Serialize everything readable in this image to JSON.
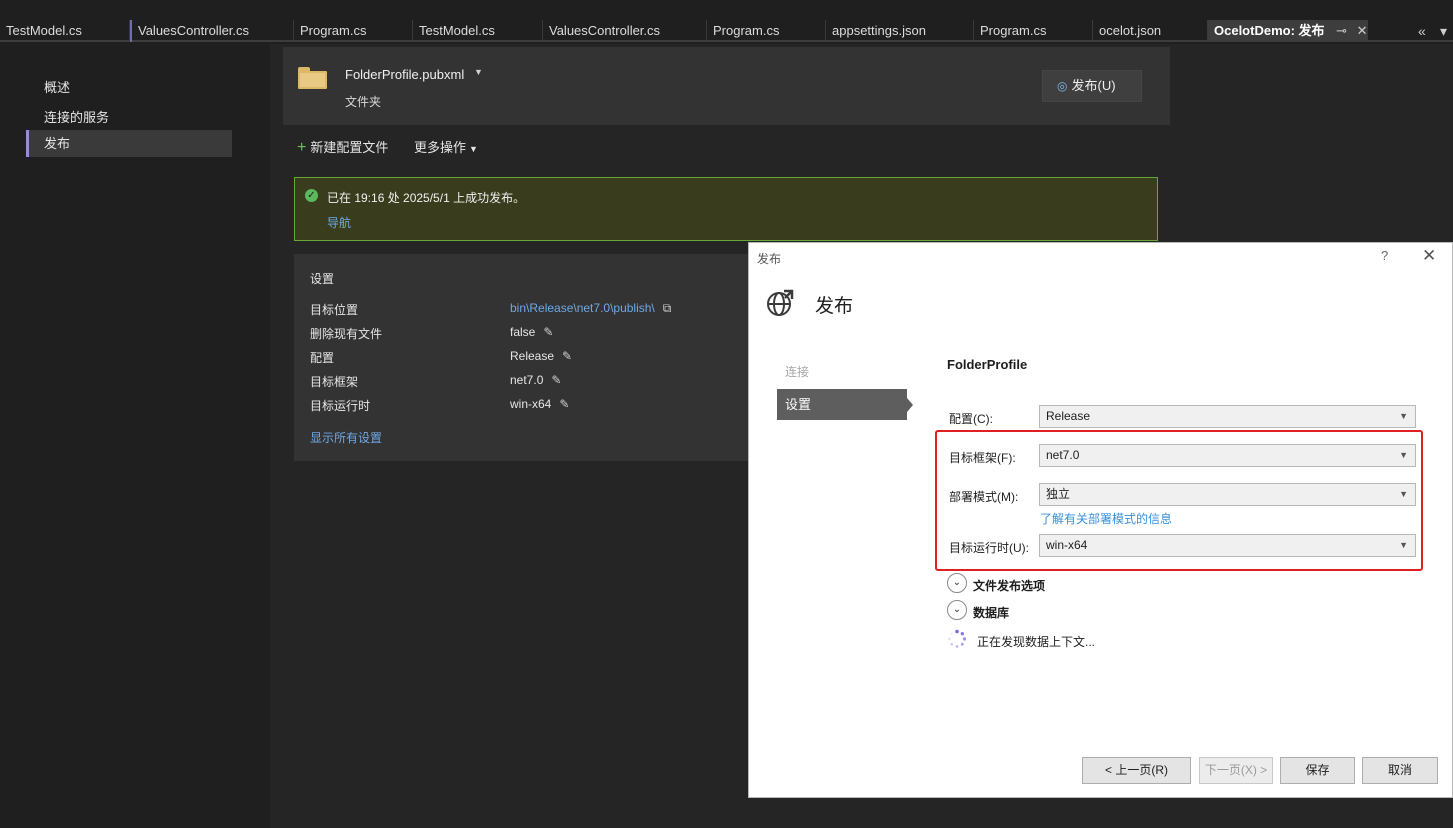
{
  "tabs": [
    {
      "label": "TestModel.cs"
    },
    {
      "label": "ValuesController.cs"
    },
    {
      "label": "Program.cs"
    },
    {
      "label": "TestModel.cs"
    },
    {
      "label": "ValuesController.cs"
    },
    {
      "label": "Program.cs"
    },
    {
      "label": "appsettings.json"
    },
    {
      "label": "Program.cs"
    },
    {
      "label": "ocelot.json"
    }
  ],
  "active_tab": {
    "label": "OcelotDemo: 发布",
    "pin_icon": "pin-icon",
    "close_icon": "close-icon"
  },
  "tab_overflow": {
    "label": "«"
  },
  "left_nav": [
    {
      "label": "概述"
    },
    {
      "label": "连接的服务"
    },
    {
      "label": "发布",
      "selected": true
    }
  ],
  "profile": {
    "name": "FolderProfile.pubxml",
    "type": "文件夹",
    "publish_button": "发布(U)"
  },
  "actions": {
    "new_profile": "新建配置文件",
    "more_actions": "更多操作"
  },
  "banner": {
    "message": "已在 19:16 处 2025/5/1 上成功发布。",
    "link": "导航"
  },
  "settings": {
    "title": "设置",
    "rows": [
      {
        "label": "目标位置",
        "value": "bin\\Release\\net7.0\\publish\\"
      },
      {
        "label": "删除现有文件",
        "value": "false"
      },
      {
        "label": "配置",
        "value": "Release"
      },
      {
        "label": "目标框架",
        "value": "net7.0"
      },
      {
        "label": "目标运行时",
        "value": "win-x64"
      }
    ],
    "show_all": "显示所有设置"
  },
  "dialog": {
    "title": "发布",
    "help": "?",
    "heading": "发布",
    "steps": {
      "connect": "连接",
      "settings": "设置"
    },
    "profile_title": "FolderProfile",
    "fields": {
      "configuration": {
        "label": "配置(C):",
        "value": "Release"
      },
      "framework": {
        "label": "目标框架(F):",
        "value": "net7.0"
      },
      "deploy_mode": {
        "label": "部署模式(M):",
        "value": "独立"
      },
      "runtime": {
        "label": "目标运行时(U):",
        "value": "win-x64"
      }
    },
    "deploy_mode_link": "了解有关部署模式的信息",
    "expanders": {
      "file_publish": "文件发布选项",
      "database": "数据库"
    },
    "loading": "正在发现数据上下文...",
    "buttons": {
      "prev": "< 上一页(R)",
      "next": "下一页(X) >",
      "save": "保存",
      "cancel": "取消"
    }
  },
  "colors": {
    "accent": "#9a8cd0",
    "success_border": "#6aa73b",
    "link": "#6ea9e6",
    "highlight": "#e02020"
  }
}
